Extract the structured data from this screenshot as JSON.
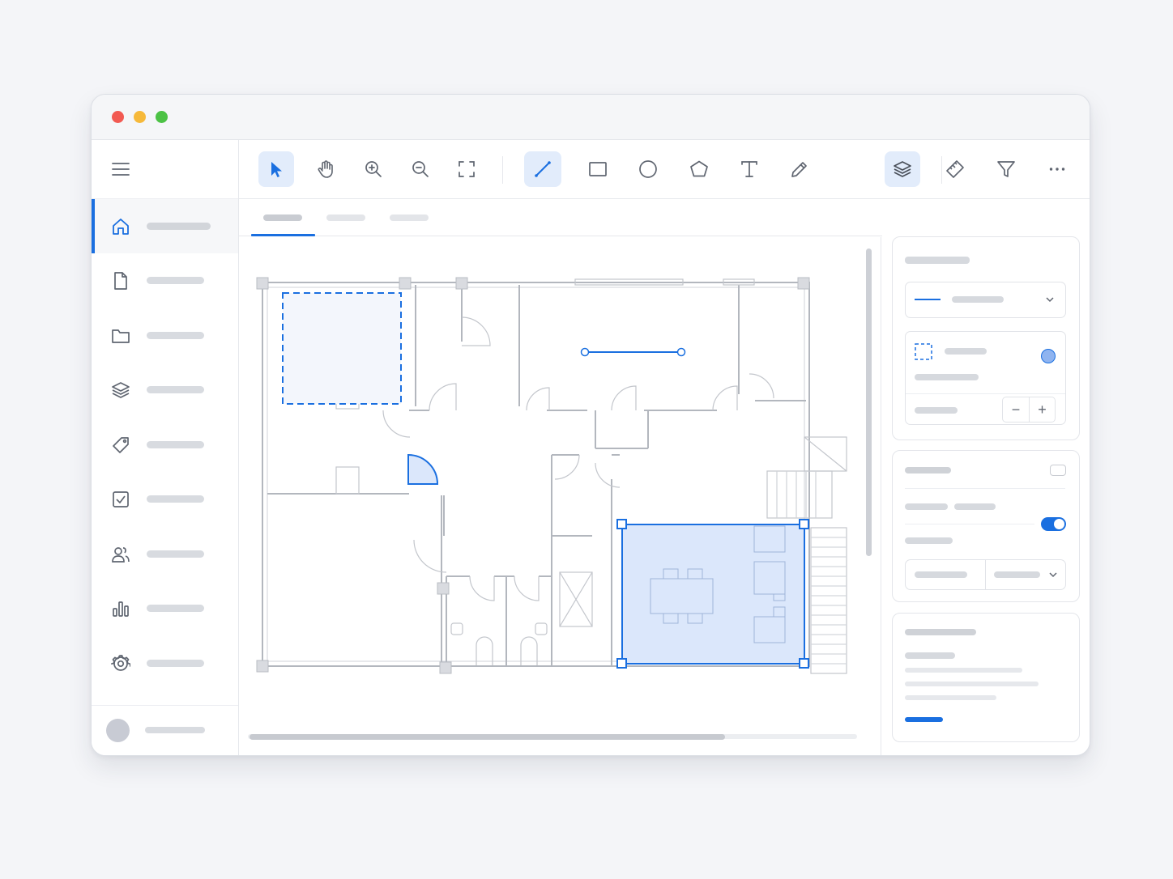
{
  "window": {
    "controls": [
      "close",
      "minimize",
      "zoom"
    ]
  },
  "colors": {
    "accent": "#1a6fe0",
    "selection_fill": "#dbe7fb",
    "wall": "#b3b7be"
  },
  "sidebar": {
    "menu_icon": "hamburger-menu-icon",
    "items": [
      {
        "icon": "home-icon",
        "label": "",
        "active": true
      },
      {
        "icon": "file-icon",
        "label": ""
      },
      {
        "icon": "folder-icon",
        "label": ""
      },
      {
        "icon": "layers-icon",
        "label": ""
      },
      {
        "icon": "tag-icon",
        "label": ""
      },
      {
        "icon": "checkbox-icon",
        "label": ""
      },
      {
        "icon": "users-icon",
        "label": ""
      },
      {
        "icon": "bar-chart-icon",
        "label": ""
      },
      {
        "icon": "gear-icon",
        "label": ""
      }
    ],
    "user": {
      "avatar": "avatar",
      "name": ""
    }
  },
  "toolbar": {
    "tools": [
      {
        "name": "select-tool",
        "icon": "cursor-arrow-icon",
        "active": true
      },
      {
        "name": "pan-tool",
        "icon": "hand-icon"
      },
      {
        "name": "zoom-in-tool",
        "icon": "zoom-in-icon"
      },
      {
        "name": "zoom-out-tool",
        "icon": "zoom-out-icon"
      },
      {
        "name": "fit-screen-tool",
        "icon": "fullscreen-icon"
      },
      {
        "name": "line-tool",
        "icon": "line-icon",
        "active": true
      },
      {
        "name": "rectangle-tool",
        "icon": "rectangle-icon"
      },
      {
        "name": "circle-tool",
        "icon": "circle-icon"
      },
      {
        "name": "polygon-tool",
        "icon": "pentagon-icon"
      },
      {
        "name": "text-tool",
        "icon": "text-icon"
      },
      {
        "name": "pencil-tool",
        "icon": "pencil-icon"
      },
      {
        "name": "layers-tool",
        "icon": "layers-icon",
        "active": true
      },
      {
        "name": "measure-tool",
        "icon": "ruler-icon"
      },
      {
        "name": "filter-tool",
        "icon": "filter-icon"
      },
      {
        "name": "more-tool",
        "icon": "more-horizontal-icon"
      }
    ]
  },
  "tabs": [
    {
      "label": "",
      "active": true
    },
    {
      "label": ""
    },
    {
      "label": ""
    }
  ],
  "canvas": {
    "content": "floor-plan",
    "selected_room": "selected-room",
    "dashed_selection": "dashed-selection"
  },
  "properties": {
    "section_title": "",
    "stroke_select": {
      "value": "",
      "icon": "chevron-down-icon"
    },
    "fill": {
      "label": "",
      "sublabel": "",
      "swatch_color": "#8fb4f0",
      "stepper_label": "",
      "minus": "−",
      "plus": "+"
    },
    "layer_title": "",
    "toggle_label_a": "",
    "toggle_label_b": "",
    "toggle_on": true,
    "row_label": "",
    "select_left": "",
    "select_right": "",
    "info_title": "",
    "info_subtitle": "",
    "info_line_1": "",
    "info_line_2": "",
    "info_line_3": "",
    "info_link": ""
  }
}
